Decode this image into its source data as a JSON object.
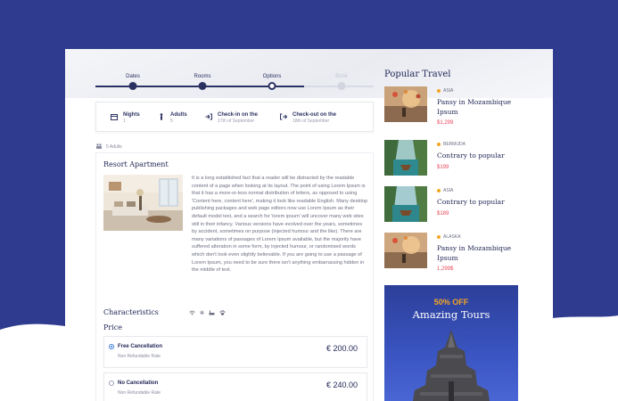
{
  "steps": [
    {
      "label": "Dates",
      "state": "done"
    },
    {
      "label": "Rooms",
      "state": "done"
    },
    {
      "label": "Options",
      "state": "current"
    },
    {
      "label": "Book",
      "state": "pending"
    }
  ],
  "summary": {
    "nights": {
      "label": "Nights",
      "value": "1",
      "icon": "calendar-icon"
    },
    "adults": {
      "label": "Adults",
      "value": "5",
      "icon": "person-icon"
    },
    "checkin": {
      "label": "Check-in on the",
      "value": "17th of September",
      "icon": "login-icon"
    },
    "checkout": {
      "label": "Check-out on the",
      "value": "18th of September",
      "icon": "logout-icon"
    }
  },
  "adults_line": "5 Adults",
  "resort": {
    "title": "Resort Apartment",
    "description": "It is a long established fact that a reader will be distracted by the readable content of a page when looking at its layout. The point of using Lorem Ipsum is that it has a more-or-less normal distribution of letters, as opposed to using 'Content here, content here', making it look like readable English. Many desktop publishing packages and web page editors now use Lorem Ipsum as their default model text, and a search for 'lorem ipsum' will uncover many web sites still in their infancy. Various versions have evolved over the years, sometimes by accident, sometimes on purpose (injected humour and the like). There are many variations of passages of Lorem Ipsum available, but the majority have suffered alteration in some form, by injected humour, or randomised words which don't look even slightly believable. If you are going to use a passage of Lorem Ipsum, you need to be sure there isn't anything embarrassing hidden in the middle of text.",
    "characteristics_title": "Characteristics",
    "characteristics_icons": [
      "wifi-icon",
      "snowflake-icon",
      "bath-icon",
      "pet-icon"
    ],
    "price_title": "Price",
    "options": [
      {
        "name": "Free Cancellation",
        "sub": "Non Refundable Rate",
        "price": "€ 200.00",
        "selected": true
      },
      {
        "name": "No Cancellation",
        "sub": "Non Refundable Rate",
        "price": "€ 240.00",
        "selected": false
      }
    ]
  },
  "popular": {
    "title": "Popular Travel",
    "items": [
      {
        "category": "ASIA",
        "name": "Pansy in Mozambique Ipsum",
        "price": "$1,299"
      },
      {
        "category": "BERMUDA",
        "name": "Contrary to popular",
        "price": "$199"
      },
      {
        "category": "ASIA",
        "name": "Contrary to popular",
        "price": "$189"
      },
      {
        "category": "ALASKA",
        "name": "Pansy in Mozambique Ipsum",
        "price": "1,299$"
      }
    ]
  },
  "banner": {
    "discount": "50% OFF",
    "title": "Amazing Tours"
  },
  "colors": {
    "navy": "#2f3b8f",
    "accent_price": "#e8485b",
    "category_dot": "#f5a623"
  }
}
